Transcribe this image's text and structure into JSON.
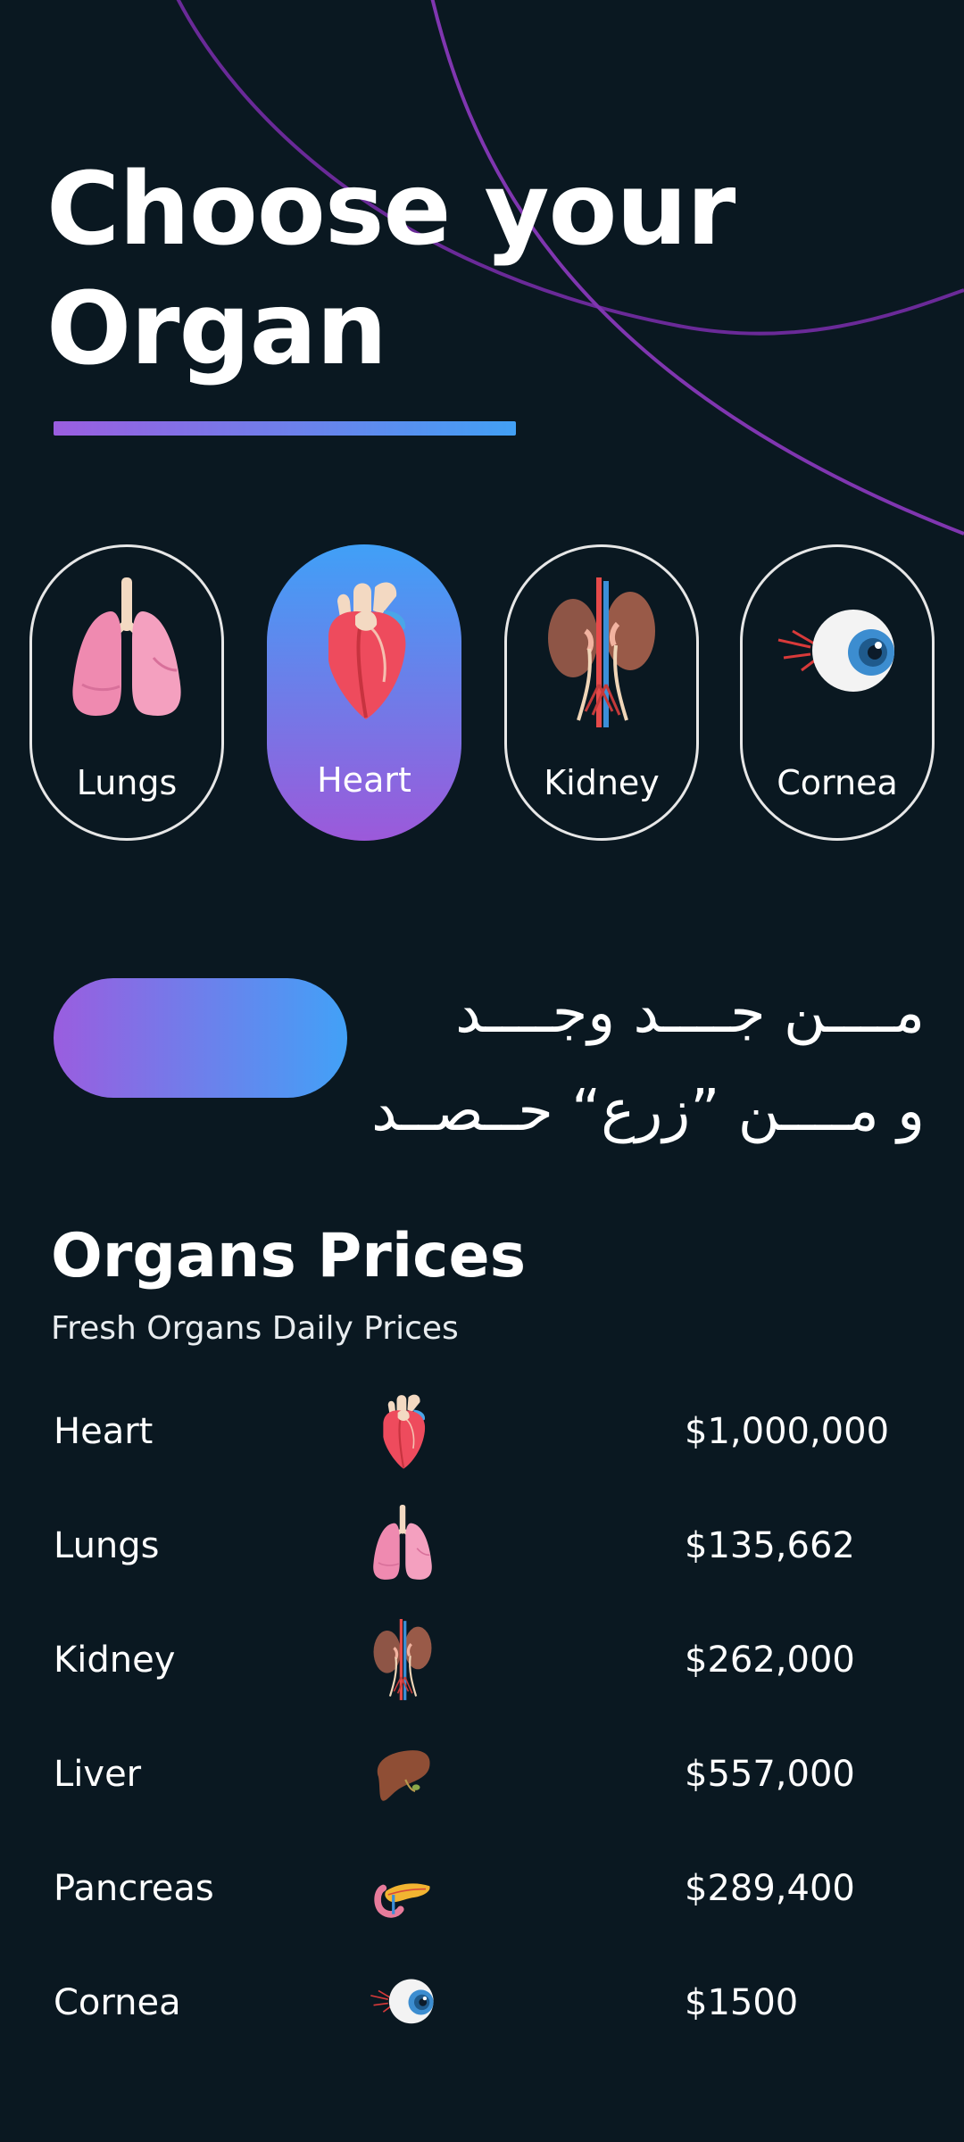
{
  "header": {
    "title_line1": "Choose your",
    "title_line2": "Organ"
  },
  "organ_cards": [
    {
      "label": "Lungs",
      "icon": "lungs-icon",
      "selected": false
    },
    {
      "label": "Heart",
      "icon": "heart-icon",
      "selected": true
    },
    {
      "label": "Kidney",
      "icon": "kidney-icon",
      "selected": false
    },
    {
      "label": "Cornea",
      "icon": "eye-icon",
      "selected": false
    }
  ],
  "promo": {
    "text_line1": "مــــن جــــد وجــــد",
    "text_line2": "و مــــن ”زرع“ حــصــد"
  },
  "prices_section": {
    "title": "Organs Prices",
    "subtitle": "Fresh Organs Daily Prices",
    "rows": [
      {
        "name": "Heart",
        "icon": "heart-icon",
        "price": "$1,000,000"
      },
      {
        "name": "Lungs",
        "icon": "lungs-icon",
        "price": "$135,662"
      },
      {
        "name": "Kidney",
        "icon": "kidney-icon",
        "price": "$262,000"
      },
      {
        "name": "Liver",
        "icon": "liver-icon",
        "price": "$557,000"
      },
      {
        "name": "Pancreas",
        "icon": "pancreas-icon",
        "price": "$289,400"
      },
      {
        "name": "Cornea",
        "icon": "eye-icon",
        "price": "$1500"
      }
    ]
  },
  "colors": {
    "background": "#0a1821",
    "accent_purple": "#9b5ee0",
    "accent_blue": "#42a0f5",
    "arc_purple": "#7a2fa8"
  }
}
